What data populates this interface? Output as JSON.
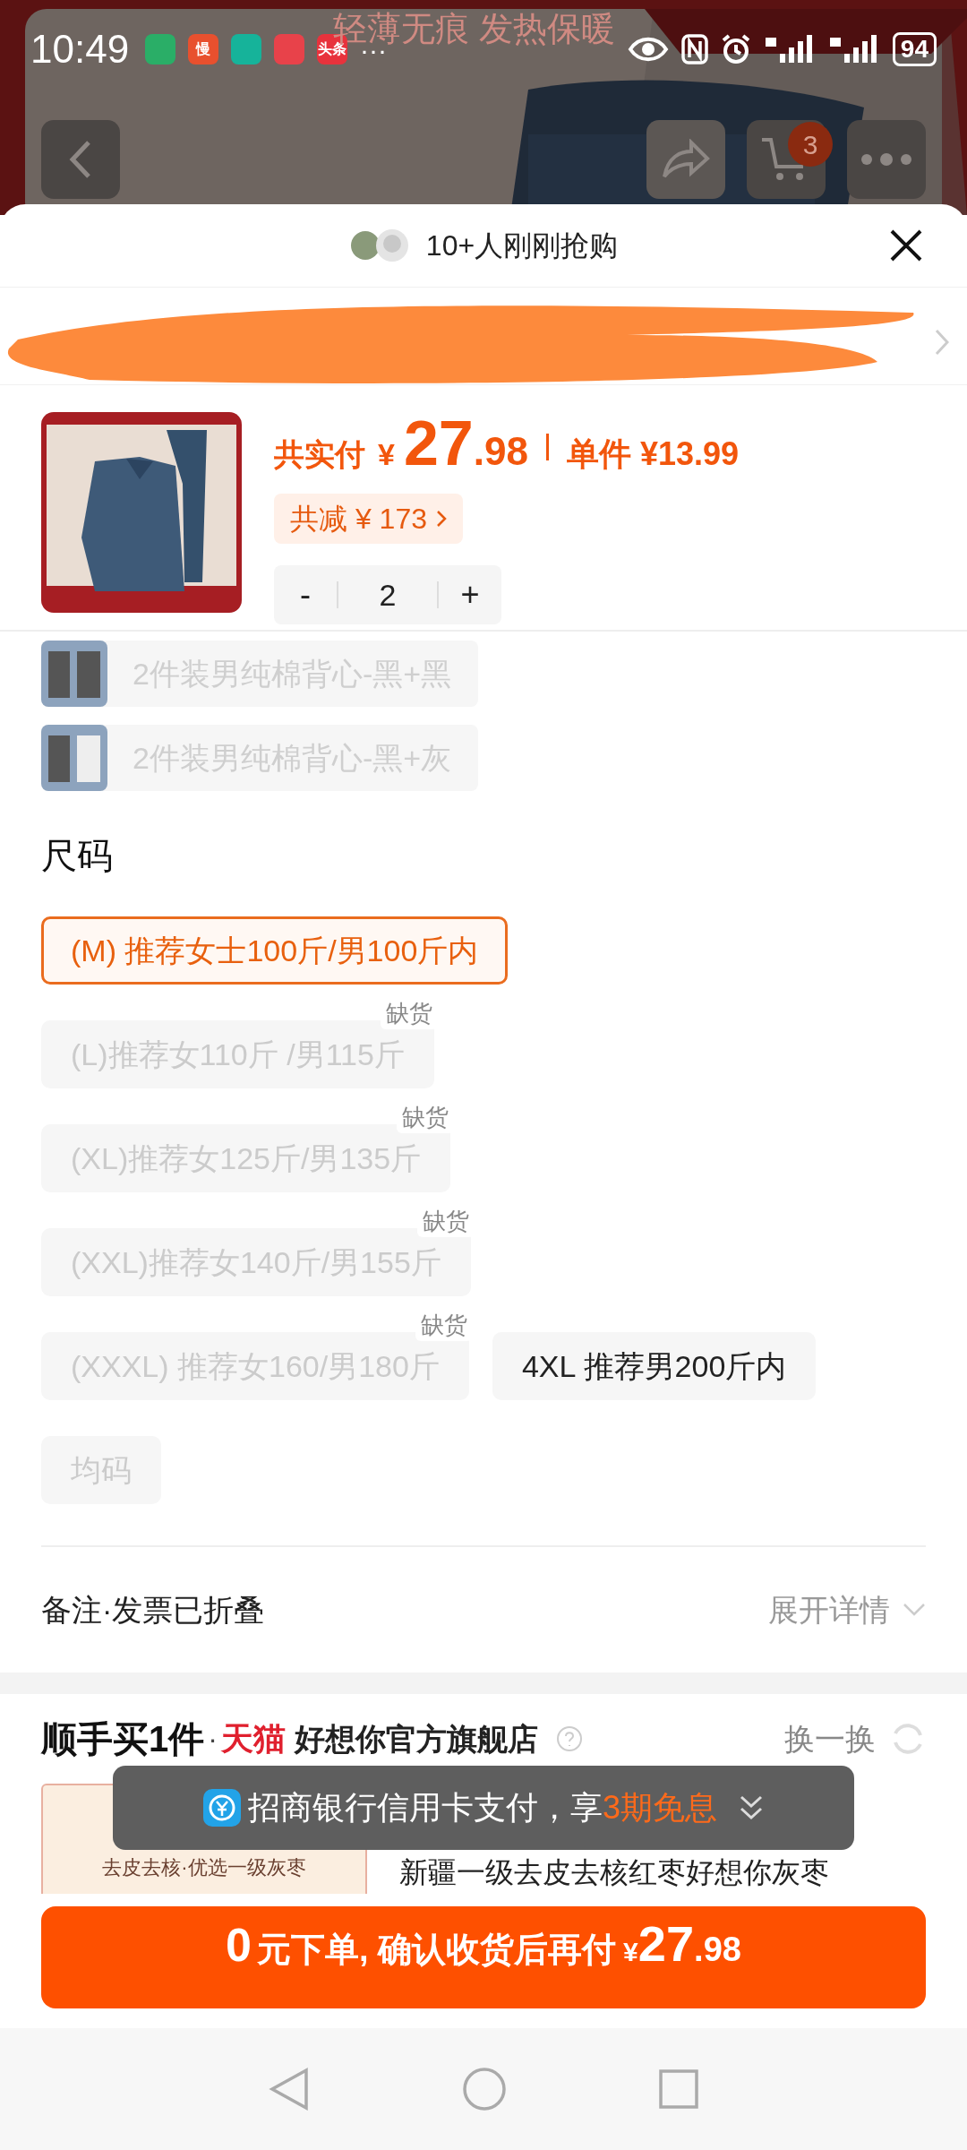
{
  "status_bar": {
    "time": "10:49",
    "apps": [
      {
        "color": "#2aae67"
      },
      {
        "color": "#e8502e",
        "label": "慢"
      },
      {
        "color": "#16b39a"
      },
      {
        "color": "#e8424a"
      },
      {
        "color": "#e8323c",
        "label": "头条"
      }
    ],
    "more": "···",
    "battery": "94"
  },
  "backdrop": {
    "banner": "轻薄无痕 发热保暖",
    "cart_count": "3"
  },
  "sheet": {
    "buyers": "10+人刚刚抢购",
    "product": {
      "total_label": "共实付",
      "currency": "¥",
      "total_int": "27",
      "total_dec": ".98",
      "unit_price": "单件 ¥13.99",
      "discount": "共减 ¥ 173",
      "quantity": "2",
      "minus": "-",
      "plus": "+"
    },
    "variants": [
      {
        "label": "2件装男纯棉背心-黑+黑",
        "disabled": true
      },
      {
        "label": "2件装男纯棉背心-黑+灰",
        "disabled": true
      }
    ],
    "size_title": "尺码",
    "sizes": [
      {
        "label": "(M) 推荐女士100斤/男100斤内",
        "selected": true,
        "disabled": false
      },
      {
        "label": "(L)推荐女110斤 /男115斤",
        "selected": false,
        "disabled": true,
        "badge": "缺货"
      },
      {
        "label": "(XL)推荐女125斤/男135斤",
        "selected": false,
        "disabled": true,
        "badge": "缺货"
      },
      {
        "label": "(XXL)推荐女140斤/男155斤",
        "selected": false,
        "disabled": true,
        "badge": "缺货"
      },
      {
        "label": "(XXXL) 推荐女160/男180斤",
        "selected": false,
        "disabled": true,
        "badge": "缺货"
      },
      {
        "label": "4XL 推荐男200斤内",
        "selected": false,
        "disabled": false
      },
      {
        "label": "均码",
        "selected": false,
        "disabled": true
      }
    ],
    "remarks": {
      "label": "备注·发票已折叠",
      "action": "展开详情"
    }
  },
  "addon": {
    "title": "顺手买1件",
    "dot": "·",
    "brand": "天猫",
    "store": "好想你官方旗舰店",
    "swap": "换一换",
    "card_caption": "去皮去核·优选一级灰枣",
    "product_title": "新疆一级去皮去核红枣好想你灰枣"
  },
  "toast": {
    "text": "招商银行信用卡支付，享",
    "highlight": "3期免息"
  },
  "buy_button": {
    "lead": "0",
    "text": "元下单, 确认收货后再付",
    "currency": "¥",
    "int": "27",
    "dec": ".98"
  }
}
